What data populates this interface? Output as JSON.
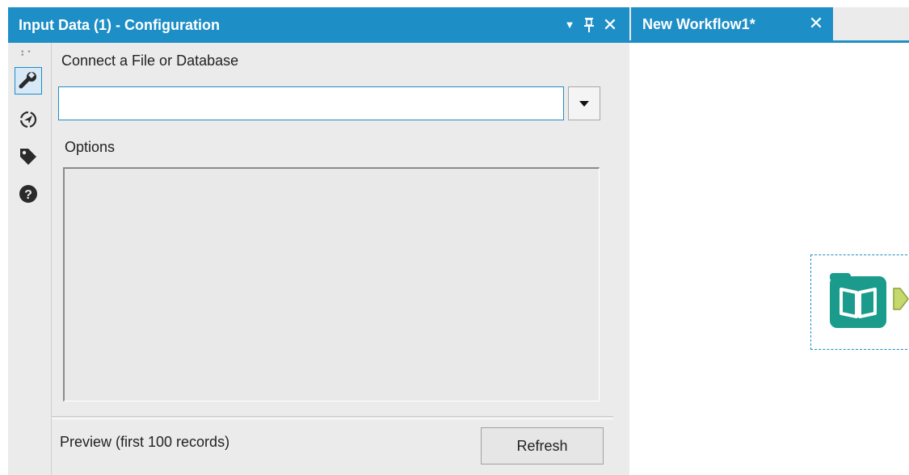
{
  "config_panel": {
    "title": "Input Data (1) - Configuration",
    "header_icons": [
      "dropdown-arrow-icon",
      "pin-icon",
      "close-icon"
    ],
    "close_glyph": "✕",
    "pin_glyph": "📌",
    "side_icons": [
      "wrench-icon",
      "navigate-icon",
      "tag-icon",
      "help-icon"
    ],
    "connect_label": "Connect a File or Database",
    "connect_value": "",
    "connect_placeholder": "",
    "options_label": "Options",
    "preview_label": "Preview (first 100 records)",
    "refresh_label": "Refresh"
  },
  "workflow": {
    "tab_label": "New Workflow1*",
    "tab_close_glyph": "✕",
    "tool_name": "input-data-tool"
  },
  "colors": {
    "accent": "#1e8ec6",
    "tool_teal": "#1a9b8c",
    "anchor_green": "#c5d86d",
    "panel_bg": "#ebebeb"
  }
}
